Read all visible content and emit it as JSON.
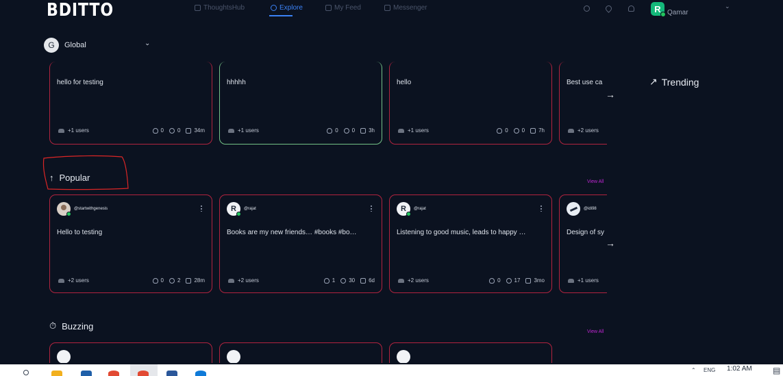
{
  "brand": {
    "logo_text": "BDITTO"
  },
  "nav": {
    "tabs": [
      {
        "label": "ThoughtsHub",
        "icon": "hub-icon"
      },
      {
        "label": "Explore",
        "icon": "compass-icon",
        "active": true
      },
      {
        "label": "My Feed",
        "icon": "home-icon"
      },
      {
        "label": "Messenger",
        "icon": "message-icon"
      }
    ],
    "user_initial": "R",
    "user_name": "Qamar"
  },
  "scope": {
    "initial": "G",
    "label": "Global"
  },
  "recent_cards": [
    {
      "text": "hello for testing",
      "users": "+1 users",
      "likes": "0",
      "comments": "0",
      "time": "34m"
    },
    {
      "text": "hhhhh",
      "users": "+1 users",
      "likes": "0",
      "comments": "0",
      "time": "3h"
    },
    {
      "text": "hello",
      "users": "+1 users",
      "likes": "0",
      "comments": "0",
      "time": "7h"
    },
    {
      "text": "Best use ca",
      "users": "+2 users"
    }
  ],
  "trending": {
    "label": "Trending"
  },
  "popular": {
    "title": "Popular",
    "view_all": "View All",
    "cards": [
      {
        "handle": "@startwithgenesis",
        "text": "Hello to testing",
        "users": "+2 users",
        "likes": "0",
        "comments": "2",
        "time": "28m"
      },
      {
        "initial": "R",
        "handle": "@rajat",
        "text": "Books are my new friends… #books #bo…",
        "users": "+2 users",
        "likes": "1",
        "comments": "30",
        "time": "6d"
      },
      {
        "initial": "R",
        "handle": "@rajat",
        "text": "Listening to good music, leads to happy …",
        "users": "+2 users",
        "likes": "0",
        "comments": "17",
        "time": "3mo"
      },
      {
        "handle": "@idi98",
        "text": "Design of sy",
        "users": "+1 users"
      }
    ]
  },
  "buzzing": {
    "title": "Buzzing",
    "view_all": "View All"
  },
  "taskbar": {
    "lang": "ENG",
    "time": "1:02 AM"
  },
  "colors": {
    "background": "#0b1220",
    "card_border": "#b3243f",
    "card_border_highlight": "#74c287",
    "accent": "#3b82f6",
    "view_all": "#c026d3"
  }
}
